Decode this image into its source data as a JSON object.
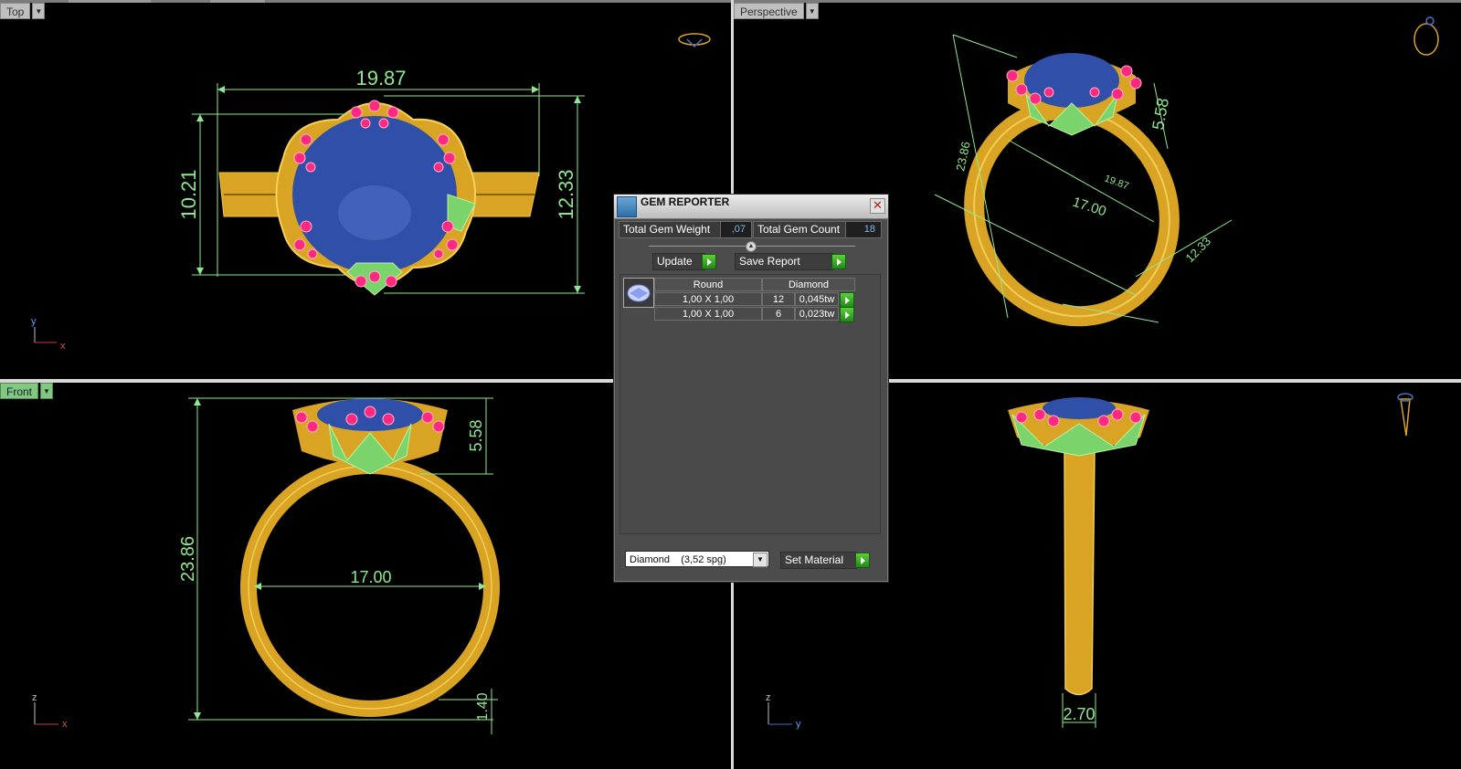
{
  "viewports": {
    "top": {
      "label": "Top",
      "axis_v": "y",
      "axis_h": "x"
    },
    "perspective": {
      "label": "Perspective"
    },
    "front": {
      "label": "Front",
      "axis_v": "z",
      "axis_h": "x"
    },
    "right": {
      "axis_v": "z",
      "axis_h": "y"
    }
  },
  "dimensions": {
    "top_width": "19.87",
    "top_height_left": "10.21",
    "top_height_right": "12.33",
    "persp_height": "23.86",
    "persp_head": "5.58",
    "persp_diameter": "17.00",
    "persp_width": "19.87",
    "persp_right": "12.33",
    "persp_band": "1.40",
    "persp_small": "2.70",
    "front_head": "5.58",
    "front_height": "23.86",
    "front_diameter": "17.00",
    "front_band": "1.40",
    "side_band_width": "2.70"
  },
  "dialog": {
    "title": "GEM REPORTER",
    "total_weight_label": "Total Gem Weight",
    "total_weight_value": ",07",
    "total_count_label": "Total Gem Count",
    "total_count_value": "18",
    "update_label": "Update",
    "save_label": "Save Report",
    "columns": [
      "Round",
      "Diamond"
    ],
    "rows": [
      {
        "size": "1,00 X 1,00",
        "count": "12",
        "weight": "0,045tw"
      },
      {
        "size": "1,00 X 1,00",
        "count": "6",
        "weight": "0,023tw"
      }
    ],
    "material_value": "Diamond    (3,52 spg)",
    "set_material_label": "Set Material"
  },
  "colors": {
    "gold": "#d9a423",
    "green_dims": "#8fe88f",
    "gem_blue": "#2f4fa8",
    "pink_stones": "#ff2a7f",
    "viewport_bg": "#000000"
  }
}
